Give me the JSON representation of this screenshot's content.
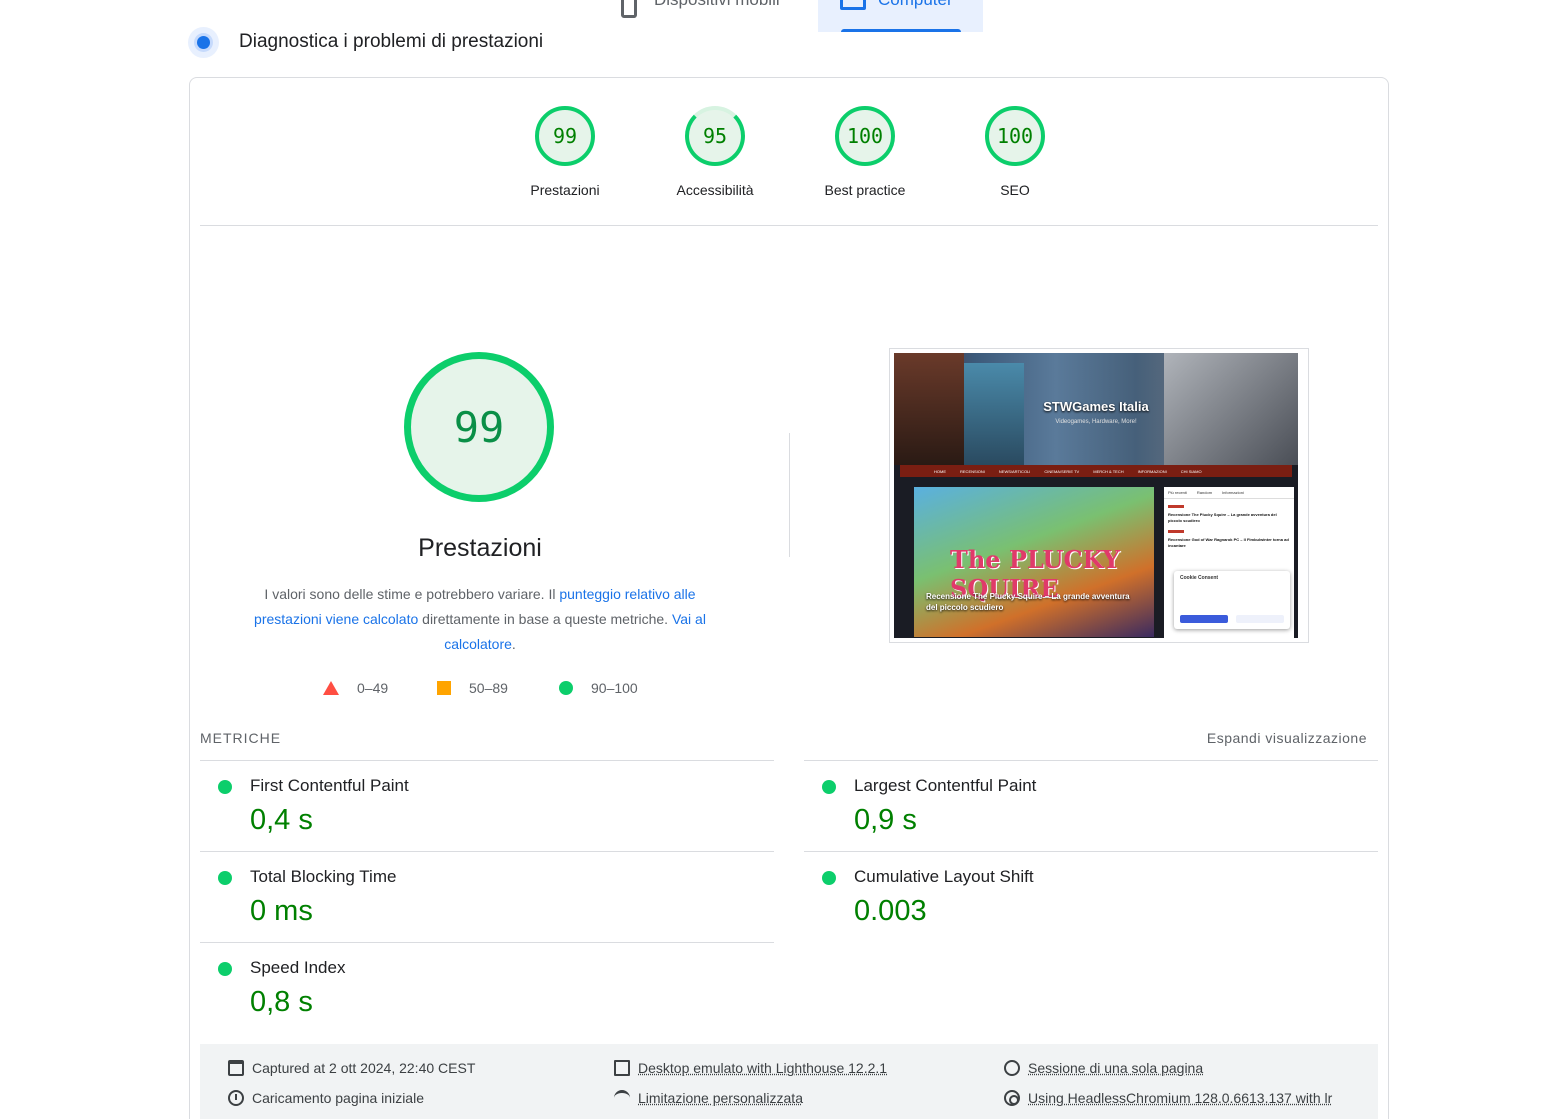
{
  "device_tabs": {
    "mobile": "Dispositivi mobili",
    "desktop": "Computer"
  },
  "header": {
    "title": "Diagnostica i problemi di prestazioni"
  },
  "gauges": [
    {
      "score": "99",
      "label": "Prestazioni"
    },
    {
      "score": "95",
      "label": "Accessibilità"
    },
    {
      "score": "100",
      "label": "Best practice"
    },
    {
      "score": "100",
      "label": "SEO"
    }
  ],
  "performance": {
    "score": "99",
    "title": "Prestazioni",
    "desc_1": "I valori sono delle stime e potrebbero variare. Il ",
    "desc_link_1": "punteggio relativo alle prestazioni viene calcolato",
    "desc_2": " direttamente in base a queste metriche. ",
    "desc_link_2": "Vai al calcolatore",
    "desc_3": "."
  },
  "legend": {
    "fail": "0–49",
    "average": "50–89",
    "pass": "90–100"
  },
  "colors": {
    "pass": "#0cce6b",
    "average": "#ffa400",
    "fail": "#ff4e42",
    "link": "#1a73e8",
    "value_green": "#008000"
  },
  "thumbnail": {
    "site_title": "STWGames Italia",
    "site_subtitle": "Videogames, Hardware, More!",
    "nav": [
      "HOME",
      "RECENSIONI",
      "NEWS/ARTICOLI",
      "CINEMA/SERIE TV",
      "MERCH & TECH",
      "INFORMAZIONI",
      "CHI SIAMO"
    ],
    "hero_art": "The PLUCKY SQUIRE",
    "hero_caption": "Recensione The Plucky Squire – La grande avventura del piccolo scudiero",
    "side_tabs": [
      "Più recenti",
      "Random",
      "Informazioni"
    ],
    "side_items": [
      "Recensione The Plucky Squire – La grande avventura del piccolo scudiero",
      "Recensione God of War Ragnarok PC – Il Fimbulwinter torna ad incantare"
    ],
    "cookie_title": "Cookie Consent"
  },
  "metrics": {
    "section_label": "METRICHE",
    "expand_label": "Espandi visualizzazione",
    "items": [
      {
        "name": "First Contentful Paint",
        "value": "0,4 s"
      },
      {
        "name": "Largest Contentful Paint",
        "value": "0,9 s"
      },
      {
        "name": "Total Blocking Time",
        "value": "0 ms"
      },
      {
        "name": "Cumulative Layout Shift",
        "value": "0.003"
      },
      {
        "name": "Speed Index",
        "value": "0,8 s"
      }
    ]
  },
  "run_info": {
    "captured": "Captured at 2 ott 2024, 22:40 CEST",
    "device": "Desktop emulato with Lighthouse 12.2.1",
    "session": "Sessione di una sola pagina",
    "load": "Caricamento pagina iniziale",
    "throttling": "Limitazione personalizzata",
    "browser": "Using HeadlessChromium 128.0.6613.137 with lr"
  }
}
